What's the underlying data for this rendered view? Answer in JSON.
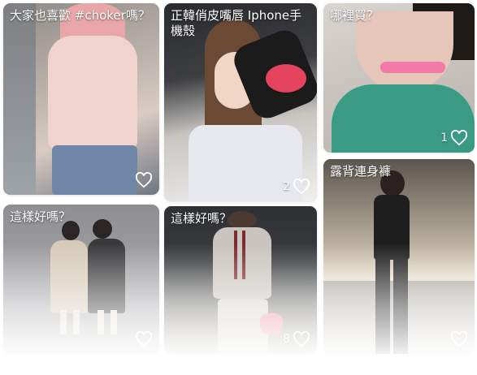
{
  "posts": [
    {
      "caption": "大家也喜歡 #choker嗎？",
      "likes": ""
    },
    {
      "caption": "正韓俏皮嘴唇 Iphone手機殼",
      "likes": "2"
    },
    {
      "caption": "哪裡買？",
      "likes": "1"
    },
    {
      "caption": "這樣好嗎？",
      "likes": ""
    },
    {
      "caption": "這樣好嗎？",
      "likes": "8"
    },
    {
      "caption": "露背連身褲",
      "likes": ""
    }
  ],
  "icons": {
    "like": "heart-outline-icon"
  },
  "colors": {
    "caption_text": "#ffffff",
    "card_bg": "#dddddd"
  }
}
